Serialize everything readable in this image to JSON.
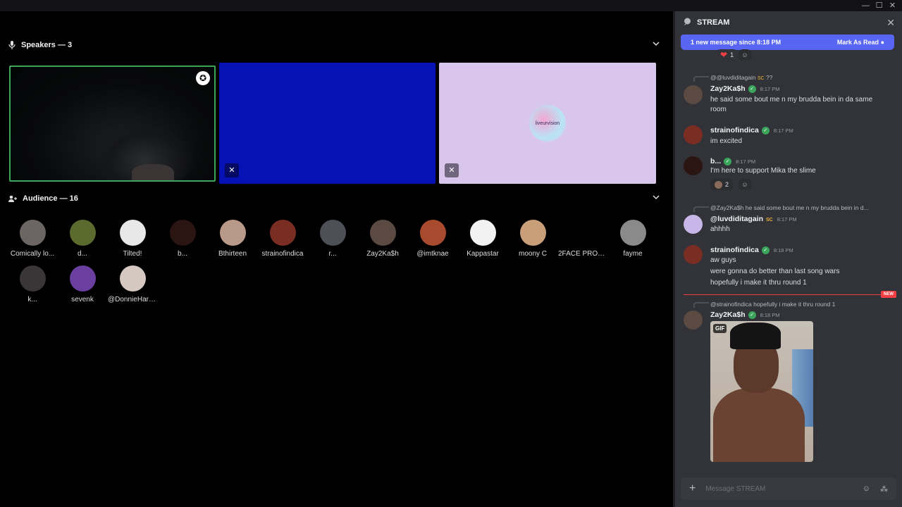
{
  "window": {
    "controls": [
      "—",
      "☐",
      "✕"
    ]
  },
  "speakers": {
    "title": "Speakers — 3",
    "icon": "microphone-icon"
  },
  "audience": {
    "title": "Audience — 16",
    "icon": "audience-icon",
    "members": [
      {
        "name": "Comically lo...",
        "color": "#6b6663"
      },
      {
        "name": "d...",
        "color": "#5b6a2e"
      },
      {
        "name": "Tilted!",
        "color": "#e8e8e8"
      },
      {
        "name": "b...",
        "color": "#2a1512"
      },
      {
        "name": "Bthirteen",
        "color": "#b99a8a"
      },
      {
        "name": "strainofindica",
        "color": "#7a2d22"
      },
      {
        "name": "r...",
        "color": "#4e5058"
      },
      {
        "name": "Zay2Ka$h",
        "color": "#5a4a42"
      },
      {
        "name": "@imtknae",
        "color": "#a84a2d"
      },
      {
        "name": "Kappastar",
        "color": "#f2f2f2"
      },
      {
        "name": "moony C",
        "color": "#c99f7a"
      },
      {
        "name": "2FACE PRON...",
        "color": "#000000"
      },
      {
        "name": "fayme",
        "color": "#8a8a8a"
      },
      {
        "name": "k...",
        "color": "#3a3638"
      },
      {
        "name": "sevenk",
        "color": "#6a3fa0"
      },
      {
        "name": "@DonnieHard...",
        "color": "#d4c8c0"
      }
    ]
  },
  "tiles": {
    "t3_logo_text": "liveurvision"
  },
  "chat": {
    "title": "STREAM",
    "banner": {
      "text": "1 new message since 8:18 PM",
      "mark": "Mark As Read"
    },
    "top_reaction": {
      "emoji": "❤",
      "count": "1"
    },
    "messages": [
      {
        "reply_user": "@@luvdiditagain",
        "reply_tag": "SC",
        "reply_text": "??",
        "user": "Zay2Ka$h",
        "time": "8:17 PM",
        "lines": [
          "he said some bout me n my brudda bein in da same",
          "room"
        ],
        "avatar_color": "#5a4a42"
      },
      {
        "user": "strainofindica",
        "time": "8:17 PM",
        "lines": [
          "im excited"
        ],
        "avatar_color": "#7a2d22"
      },
      {
        "user": "b...",
        "time": "8:17 PM",
        "lines": [
          "I'm here to support Mika the slime"
        ],
        "reaction_count": "2",
        "avatar_color": "#2a1512"
      },
      {
        "reply_user": "@Zay2Ka$h",
        "reply_text": "he said some bout me n my brudda bein in d...",
        "user": "@luvdiditagain",
        "tag": "SC",
        "time": "8:17 PM",
        "lines": [
          "ahhhh"
        ],
        "avatar_color": "#c9b6e8"
      },
      {
        "user": "strainofindica",
        "time": "8:18 PM",
        "lines": [
          "aw guys",
          "were gonna do better than last song wars",
          "hopefully i make it thru round 1"
        ],
        "avatar_color": "#7a2d22"
      },
      {
        "reply_user": "@strainofindica",
        "reply_text": "hopefully i make it thru round 1",
        "user": "Zay2Ka$h",
        "time": "8:18 PM",
        "gif_label": "GIF",
        "avatar_color": "#5a4a42"
      }
    ],
    "new_tag": "NEW",
    "composer_placeholder": "Message STREAM"
  }
}
